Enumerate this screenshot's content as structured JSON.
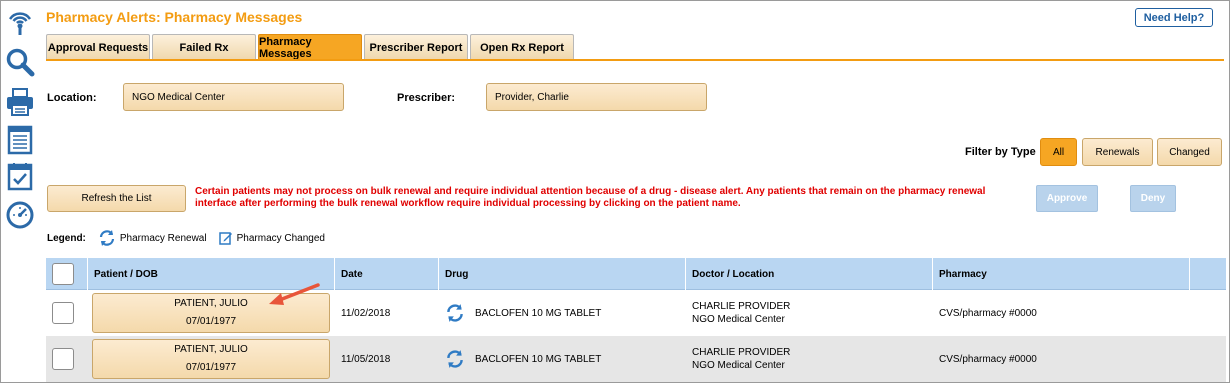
{
  "app": {
    "title": "Pharmacy Alerts: Pharmacy Messages",
    "help_label": "Need Help?"
  },
  "sidebar": {
    "icons": [
      "wireless-icon",
      "search-icon",
      "printer-icon",
      "document-icon",
      "checklist-icon",
      "dashboard-icon"
    ]
  },
  "tabs": [
    {
      "label": "Approval Requests",
      "active": false
    },
    {
      "label": "Failed Rx",
      "active": false
    },
    {
      "label": "Pharmacy Messages",
      "active": true
    },
    {
      "label": "Prescriber Report",
      "active": false
    },
    {
      "label": "Open Rx Report",
      "active": false
    }
  ],
  "filters": {
    "location_label": "Location:",
    "location_value": "NGO Medical Center",
    "prescriber_label": "Prescriber:",
    "prescriber_value": "Provider, Charlie",
    "type_label": "Filter by Type",
    "type_options": [
      "All",
      "Renewals",
      "Changed"
    ],
    "type_selected": "All"
  },
  "actions": {
    "refresh_label": "Refresh the List",
    "alert_message": "Certain patients may not process on bulk renewal and require individual attention because of a drug - disease alert. Any patients that remain on the pharmacy renewal interface after performing the bulk renewal workflow require individual processing by clicking on the patient name.",
    "approve_label": "Approve",
    "deny_label": "Deny"
  },
  "legend": {
    "title": "Legend:",
    "renewal_label": "Pharmacy Renewal",
    "changed_label": "Pharmacy Changed"
  },
  "table": {
    "columns": [
      "Patient / DOB",
      "Date",
      "Drug",
      "Doctor / Location",
      "Pharmacy"
    ],
    "rows": [
      {
        "patient": "PATIENT, JULIO",
        "dob": "07/01/1977",
        "date": "11/02/2018",
        "drug": "BACLOFEN 10 MG TABLET",
        "doctor": "CHARLIE PROVIDER",
        "location": "NGO Medical Center",
        "pharmacy": "CVS/pharmacy #0000",
        "type_icon": "renewal-icon"
      },
      {
        "patient": "PATIENT, JULIO",
        "dob": "07/01/1977",
        "date": "11/05/2018",
        "drug": "BACLOFEN 10 MG TABLET",
        "doctor": "CHARLIE PROVIDER",
        "location": "NGO Medical Center",
        "pharmacy": "CVS/pharmacy #0000",
        "type_icon": "renewal-icon"
      }
    ]
  },
  "colors": {
    "accent_orange": "#f39c12",
    "alert_red": "#e00000",
    "header_blue": "#b9d6f2",
    "link_blue": "#1f5fa0",
    "annotation_arrow": "#e8553a"
  }
}
